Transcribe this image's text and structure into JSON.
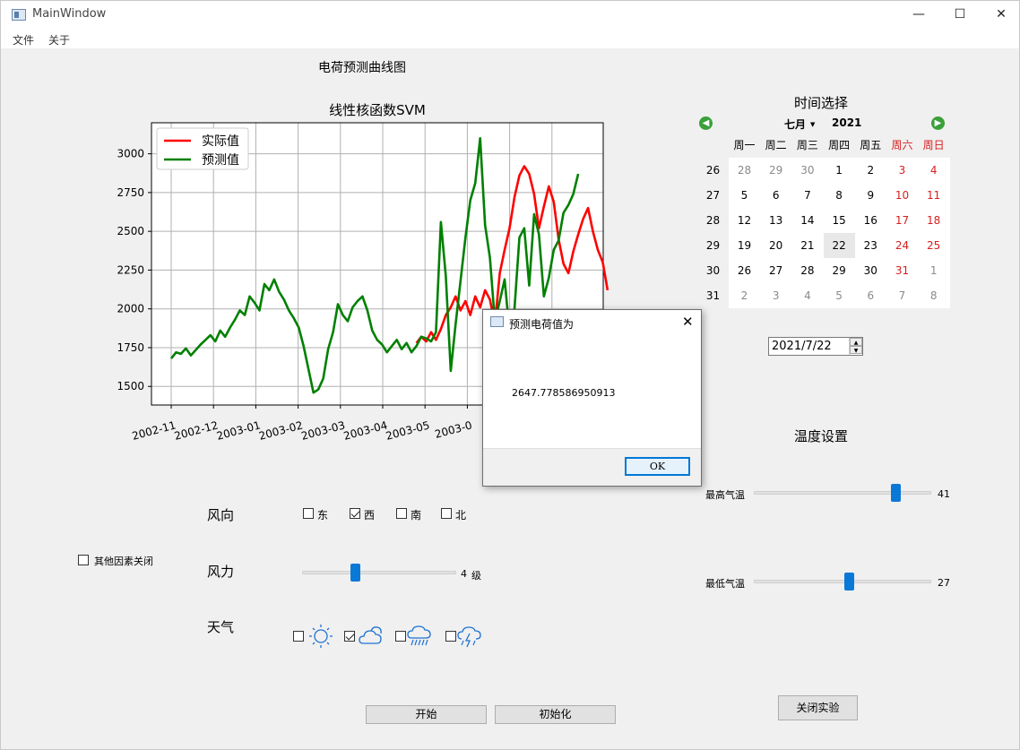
{
  "window": {
    "title": "MainWindow",
    "min": "—",
    "max": "☐",
    "close": "✕"
  },
  "menu": [
    "文件",
    "关于"
  ],
  "page_title": "电荷预测曲线图",
  "chart_data": {
    "type": "line",
    "title": "线性核函数SVM",
    "x_ticks": [
      "2002-11",
      "2002-12",
      "2003-01",
      "2003-02",
      "2003-03",
      "2003-04",
      "2003-05",
      "2003-06"
    ],
    "x_tick_visible": [
      "2002-11",
      "2002-12",
      "2003-01",
      "2003-02",
      "2003-03",
      "2003-04",
      "2003-05",
      "2003-0"
    ],
    "y_ticks": [
      1500,
      1750,
      2000,
      2250,
      2500,
      2750,
      3000
    ],
    "ylim": [
      1380,
      3200
    ],
    "grid": true,
    "legend": "top-left",
    "series": [
      {
        "name": "实际值",
        "color": "#ff0000",
        "start_index": 50,
        "values": [
          1780,
          1820,
          1790,
          1850,
          1800,
          1870,
          1960,
          2010,
          2080,
          1990,
          2050,
          1960,
          2080,
          2010,
          2120,
          2060,
          1900,
          2230,
          2380,
          2520,
          2720,
          2860,
          2920,
          2870,
          2740,
          2520,
          2660,
          2790,
          2690,
          2450,
          2290,
          2230,
          2370,
          2480,
          2580,
          2650,
          2500,
          2380,
          2300,
          2120
        ]
      },
      {
        "name": "预测值",
        "color": "#008000",
        "start_index": 0,
        "values": [
          1680,
          1720,
          1710,
          1745,
          1700,
          1735,
          1770,
          1800,
          1830,
          1790,
          1860,
          1820,
          1880,
          1930,
          1990,
          1960,
          2080,
          2040,
          1990,
          2160,
          2120,
          2190,
          2110,
          2060,
          1990,
          1940,
          1880,
          1760,
          1610,
          1460,
          1480,
          1550,
          1740,
          1850,
          2030,
          1960,
          1920,
          2010,
          2050,
          2080,
          1990,
          1860,
          1800,
          1770,
          1720,
          1760,
          1800,
          1740,
          1780,
          1720,
          1760,
          1820,
          1810,
          1790,
          1850,
          2560,
          2210,
          1600,
          1900,
          2180,
          2460,
          2700,
          2810,
          3100,
          2540,
          2330,
          1920,
          2050,
          2190,
          1850,
          2000,
          2460,
          2520,
          2150,
          2610,
          2480,
          2080,
          2200,
          2380,
          2440,
          2620,
          2670,
          2740,
          2870
        ]
      }
    ]
  },
  "wind_direction": {
    "label": "风向",
    "options": [
      {
        "label": "东",
        "checked": false
      },
      {
        "label": "西",
        "checked": true
      },
      {
        "label": "南",
        "checked": false
      },
      {
        "label": "北",
        "checked": false
      }
    ]
  },
  "wind_force": {
    "label": "风力",
    "value": 4,
    "min": 0,
    "max": 12,
    "readout": "4",
    "unit": "级"
  },
  "weather": {
    "label": "天气",
    "options": [
      {
        "icon": "sun-icon",
        "checked": false
      },
      {
        "icon": "cloudy-icon",
        "checked": true
      },
      {
        "icon": "rain-icon",
        "checked": false
      },
      {
        "icon": "thunderstorm-icon",
        "checked": false
      }
    ]
  },
  "other_factors": {
    "label": "其他因素关闭",
    "checked": false
  },
  "buttons": {
    "start": "开始",
    "init": "初始化",
    "close": "关闭实验"
  },
  "time_select": {
    "heading": "时间选择",
    "month": "七月",
    "year": "2021",
    "weekdays": [
      "周一",
      "周二",
      "周三",
      "周四",
      "周五",
      "周六",
      "周日"
    ],
    "weeks": [
      {
        "num": "26",
        "days": [
          "28",
          "29",
          "30",
          "1",
          "2",
          "3",
          "4"
        ],
        "other": [
          true,
          true,
          true,
          false,
          false,
          false,
          false
        ]
      },
      {
        "num": "27",
        "days": [
          "5",
          "6",
          "7",
          "8",
          "9",
          "10",
          "11"
        ],
        "other": [
          false,
          false,
          false,
          false,
          false,
          false,
          false
        ]
      },
      {
        "num": "28",
        "days": [
          "12",
          "13",
          "14",
          "15",
          "16",
          "17",
          "18"
        ],
        "other": [
          false,
          false,
          false,
          false,
          false,
          false,
          false
        ]
      },
      {
        "num": "29",
        "days": [
          "19",
          "20",
          "21",
          "22",
          "23",
          "24",
          "25"
        ],
        "other": [
          false,
          false,
          false,
          false,
          false,
          false,
          false
        ]
      },
      {
        "num": "30",
        "days": [
          "26",
          "27",
          "28",
          "29",
          "30",
          "31",
          "1"
        ],
        "other": [
          false,
          false,
          false,
          false,
          false,
          false,
          true
        ]
      },
      {
        "num": "31",
        "days": [
          "2",
          "3",
          "4",
          "5",
          "6",
          "7",
          "8"
        ],
        "other": [
          true,
          true,
          true,
          true,
          true,
          true,
          true
        ]
      }
    ],
    "selected": "22",
    "date_value": "2021/7/22"
  },
  "temperature": {
    "heading": "温度设置",
    "max": {
      "label": "最高气温",
      "value": 41,
      "min": 0,
      "max": 50,
      "readout": "41"
    },
    "min": {
      "label": "最低气温",
      "value": 27,
      "min": 0,
      "max": 50,
      "readout": "27"
    }
  },
  "dialog": {
    "title": "预测电荷值为",
    "message": "2647.778586950913",
    "ok": "OK"
  },
  "colors": {
    "weekend": "#d81e1e",
    "other_month": "#8a8a8a",
    "accent": "#0a78d7"
  }
}
